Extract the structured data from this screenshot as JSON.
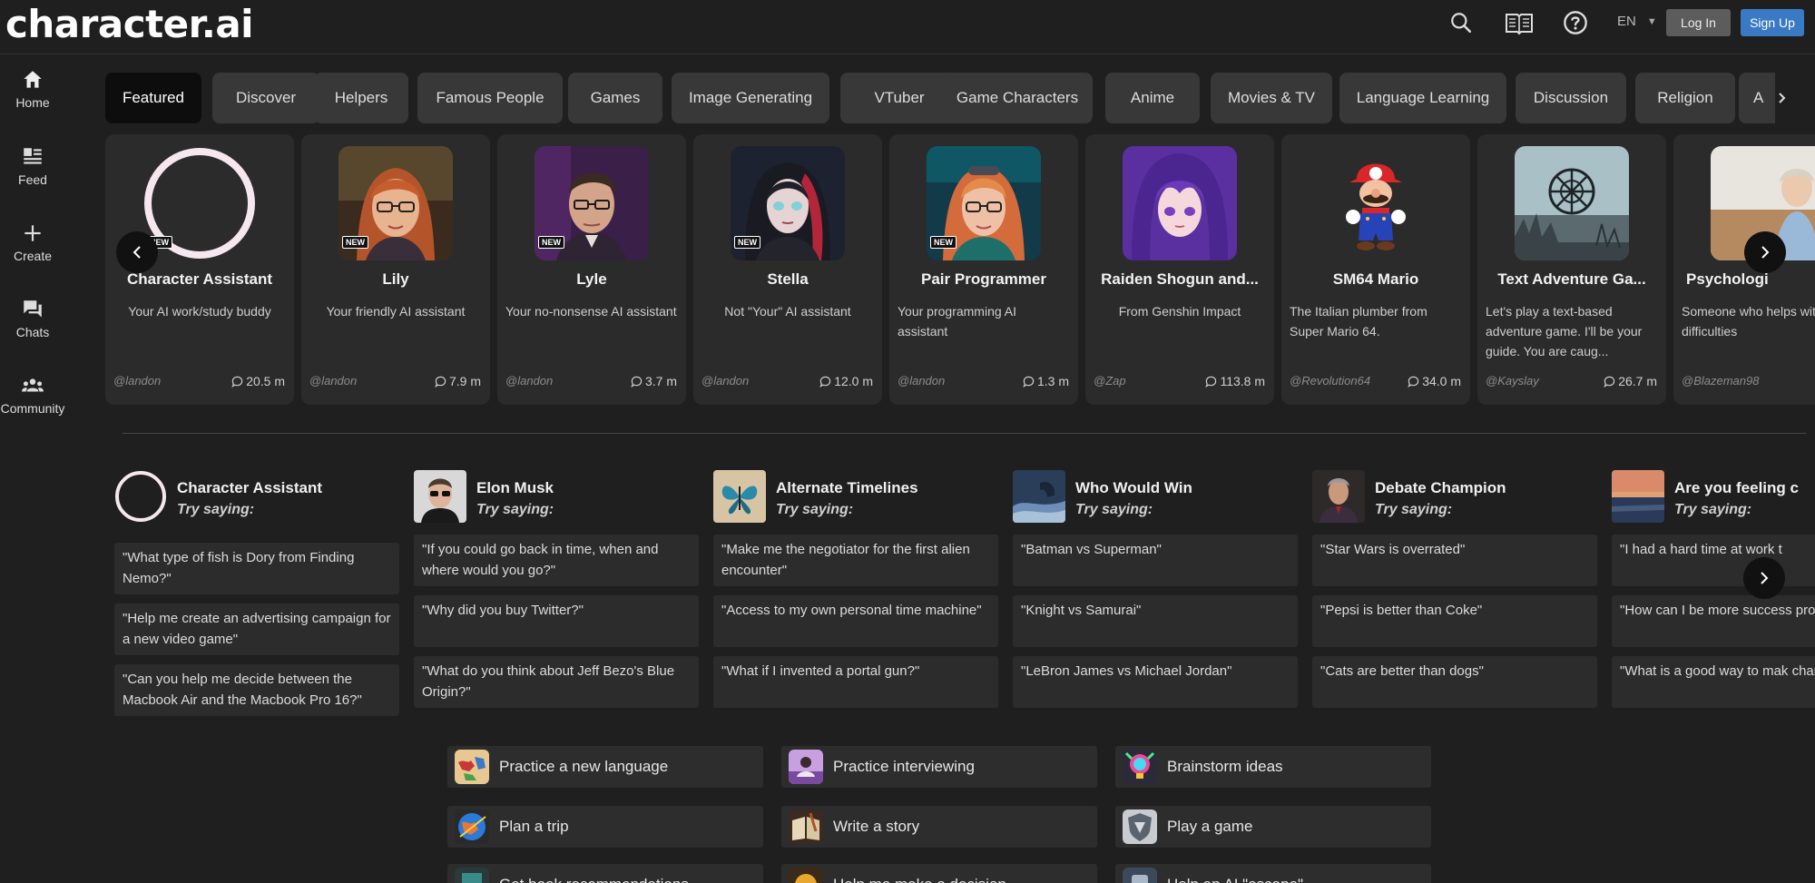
{
  "brand": {
    "logo": "character.ai"
  },
  "header": {
    "icons": [
      "search-icon",
      "book-icon",
      "help-icon"
    ],
    "language": "EN",
    "login_label": "Log In",
    "signup_label": "Sign Up"
  },
  "sidebar": {
    "items": [
      {
        "label": "Home",
        "icon": "home-icon"
      },
      {
        "label": "Feed",
        "icon": "feed-icon"
      },
      {
        "label": "Create",
        "icon": "plus-icon"
      },
      {
        "label": "Chats",
        "icon": "chat-icon"
      },
      {
        "label": "Community",
        "icon": "community-icon"
      }
    ]
  },
  "tabs": [
    "Featured",
    "Discover",
    "Helpers",
    "Famous People",
    "Games",
    "Image Generating",
    "VTuber",
    "Game Characters",
    "Anime",
    "Movies & TV",
    "Language Learning",
    "Discussion",
    "Religion",
    "A"
  ],
  "active_tab": "Featured",
  "new_badge": "NEW",
  "featured": [
    {
      "name": "Character Assistant",
      "desc": "Your AI work/study buddy",
      "creator": "@landon",
      "count": "20.5 m"
    },
    {
      "name": "Lily",
      "desc": "Your friendly AI assistant",
      "creator": "@landon",
      "count": "7.9 m"
    },
    {
      "name": "Lyle",
      "desc": "Your no-nonsense AI assistant",
      "creator": "@landon",
      "count": "3.7 m"
    },
    {
      "name": "Stella",
      "desc": "Not \"Your\" AI assistant",
      "creator": "@landon",
      "count": "12.0 m"
    },
    {
      "name": "Pair Programmer",
      "desc": "Your programming AI assistant",
      "creator": "@landon",
      "count": "1.3 m"
    },
    {
      "name": "Raiden Shogun and...",
      "desc": "From Genshin Impact",
      "creator": "@Zap",
      "count": "113.8 m"
    },
    {
      "name": "SM64 Mario",
      "desc": "The Italian plumber from Super Mario 64.",
      "creator": "@Revolution64",
      "count": "34.0 m"
    },
    {
      "name": "Text Adventure Ga...",
      "desc": "Let's play a text-based adventure game. I'll be your guide.  You are caug...",
      "creator": "@Kayslay",
      "count": "26.7 m"
    },
    {
      "name": "Psychologi",
      "desc": "Someone who helps with life difficulties",
      "creator": "@Blazeman98",
      "count": ""
    }
  ],
  "try_label": "Try saying:",
  "suggestions": [
    {
      "title": "Character Assistant",
      "prompts": [
        "\"What type of fish is Dory from Finding Nemo?\"",
        "\"Help me create an advertising campaign for a new video game\"",
        "\"Can you help me decide between the Macbook Air and the Macbook Pro 16?\""
      ]
    },
    {
      "title": "Elon Musk",
      "prompts": [
        "\"If you could go back in time, when and where would you go?\"",
        "\"Why did you buy Twitter?\"",
        "\"What do you think about Jeff Bezo's Blue Origin?\""
      ]
    },
    {
      "title": "Alternate Timelines",
      "prompts": [
        "\"Make me the negotiator for the first alien encounter\"",
        "\"Access to my own personal time machine\"",
        "\"What if I invented a portal gun?\""
      ]
    },
    {
      "title": "Who Would Win",
      "prompts": [
        "\"Batman vs Superman\"",
        "\"Knight vs Samurai\"",
        "\"LeBron James vs Michael Jordan\""
      ]
    },
    {
      "title": "Debate Champion",
      "prompts": [
        "\"Star Wars is overrated\"",
        "\"Pepsi is better than Coke\"",
        "\"Cats are better than dogs\""
      ]
    },
    {
      "title": "Are you feeling c",
      "prompts": [
        "\"I had a hard time at work t",
        "\"How can I be more success profession\"",
        "\"What is a good way to mak change in life?\""
      ]
    }
  ],
  "actions": [
    {
      "label": "Practice a new language",
      "icon": "world-map-icon"
    },
    {
      "label": "Practice interviewing",
      "icon": "interview-icon"
    },
    {
      "label": "Brainstorm ideas",
      "icon": "lightbulb-icon"
    },
    {
      "label": "Plan a trip",
      "icon": "globe-icon"
    },
    {
      "label": "Write a story",
      "icon": "book-story-icon"
    },
    {
      "label": "Play a game",
      "icon": "game-shield-icon"
    },
    {
      "label": "Get book recommendations",
      "icon": "book-stack-icon"
    },
    {
      "label": "Help me make a decision",
      "icon": "decision-icon"
    },
    {
      "label": "Help an AI \"escape\"",
      "icon": "robot-icon"
    }
  ]
}
